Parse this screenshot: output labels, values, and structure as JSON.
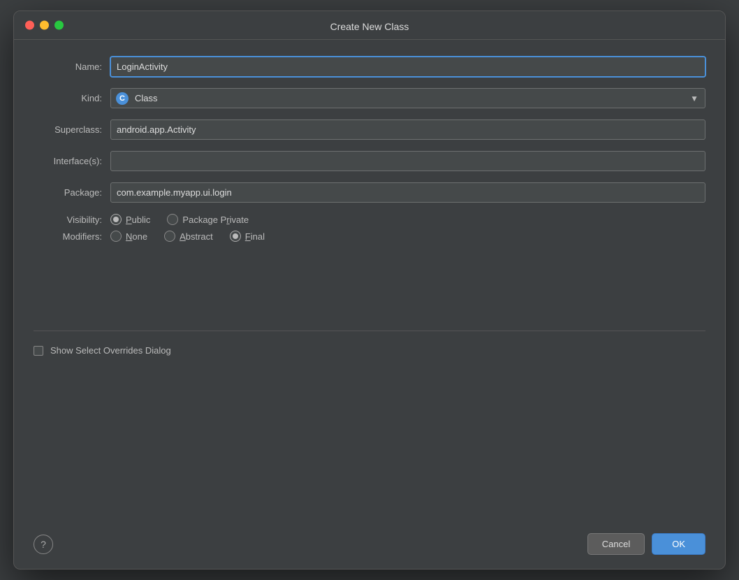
{
  "dialog": {
    "title": "Create New Class",
    "window_controls": {
      "close_label": "",
      "minimize_label": "",
      "maximize_label": ""
    }
  },
  "form": {
    "name_label": "Name:",
    "name_value": "LoginActivity",
    "kind_label": "Kind:",
    "kind_value": "Class",
    "kind_icon": "C",
    "superclass_label": "Superclass:",
    "superclass_value": "android.app.Activity",
    "interfaces_label": "Interface(s):",
    "interfaces_value": "",
    "package_label": "Package:",
    "package_value": "com.example.myapp.ui.login",
    "visibility_label": "Visibility:",
    "visibility_options": [
      {
        "id": "public",
        "label": "Public",
        "selected": true
      },
      {
        "id": "package-private",
        "label": "Package Private",
        "selected": false
      }
    ],
    "modifiers_label": "Modifiers:",
    "modifiers_options": [
      {
        "id": "none",
        "label": "None",
        "selected": false
      },
      {
        "id": "abstract",
        "label": "Abstract",
        "selected": false
      },
      {
        "id": "final",
        "label": "Final",
        "selected": true
      }
    ],
    "checkbox_label": "Show Select Overrides Dialog",
    "checkbox_checked": false
  },
  "buttons": {
    "help_label": "?",
    "cancel_label": "Cancel",
    "ok_label": "OK"
  }
}
